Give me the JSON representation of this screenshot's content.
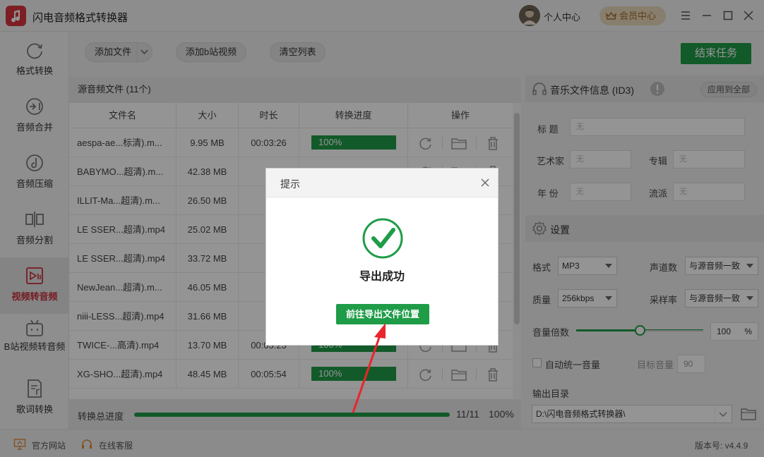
{
  "titlebar": {
    "app_title": "闪电音频格式转换器",
    "user_center": "个人中心",
    "vip_label": "会员中心"
  },
  "sidebar": {
    "items": [
      {
        "label": "格式转换",
        "icon": "refresh-icon"
      },
      {
        "label": "音频合并",
        "icon": "merge-icon"
      },
      {
        "label": "音频压缩",
        "icon": "compress-icon"
      },
      {
        "label": "音频分割",
        "icon": "split-icon"
      },
      {
        "label": "视频转音频",
        "icon": "video-audio-icon",
        "active": true
      },
      {
        "label": "B站视频转音频",
        "icon": "bilibili-icon"
      },
      {
        "label": "歌词转换",
        "icon": "lyrics-icon"
      }
    ]
  },
  "toolbar": {
    "add_file": "添加文件",
    "add_bilibili": "添加b站视频",
    "clear_list": "清空列表",
    "end_task": "结束任务"
  },
  "file_list": {
    "header": "源音频文件 (11个)",
    "columns": [
      "文件名",
      "大小",
      "时长",
      "转换进度",
      "操作"
    ],
    "rows": [
      {
        "name": "aespa-ae...标清).m...",
        "size": "9.95 MB",
        "duration": "00:03:26",
        "progress": "100%"
      },
      {
        "name": "BABYMO...超清).m...",
        "size": "42.38 MB",
        "duration": "",
        "progress": ""
      },
      {
        "name": "ILLIT-Ma...超清).m...",
        "size": "26.50 MB",
        "duration": "0",
        "progress": ""
      },
      {
        "name": "LE SSER...超清).mp4",
        "size": "25.02 MB",
        "duration": "0",
        "progress": ""
      },
      {
        "name": "LE SSER...超清).mp4",
        "size": "33.72 MB",
        "duration": "0",
        "progress": ""
      },
      {
        "name": "NewJean...超清).m...",
        "size": "46.05 MB",
        "duration": "0",
        "progress": ""
      },
      {
        "name": "niii-LESS...超清).mp4",
        "size": "31.66 MB",
        "duration": "0",
        "progress": ""
      },
      {
        "name": "TWICE-...高清).mp4",
        "size": "13.70 MB",
        "duration": "00:03:23",
        "progress": "100%"
      },
      {
        "name": "XG-SHO...超清).mp4",
        "size": "48.45 MB",
        "duration": "00:05:54",
        "progress": "100%"
      }
    ],
    "total_label": "转换总进度",
    "total_count": "11/11",
    "total_percent": "100%"
  },
  "id3": {
    "header": "音乐文件信息 (ID3)",
    "apply_all": "应用到全部",
    "title_label": "标  题",
    "artist_label": "艺术家",
    "album_label": "专辑",
    "year_label": "年  份",
    "genre_label": "流派",
    "placeholder": "无"
  },
  "settings": {
    "header": "设置",
    "format_label": "格式",
    "format_value": "MP3",
    "channels_label": "声道数",
    "channels_value": "与源音频一致",
    "quality_label": "质量",
    "quality_value": "256kbps",
    "samplerate_label": "采样率",
    "samplerate_value": "与源音频一致",
    "volume_label": "音量倍数",
    "volume_value": "100",
    "volume_unit": "%",
    "volume_level": 0.5,
    "auto_volume_label": "自动统一音量",
    "target_volume_label": "目标音量",
    "target_volume_value": "90",
    "output_dir_label": "输出目录",
    "output_dir_value": "D:\\闪电音频格式转换器\\"
  },
  "statusbar": {
    "official_site": "官方网站",
    "online_service": "在线客服",
    "version": "版本号: v4.4.9"
  },
  "dialog": {
    "title": "提示",
    "message": "导出成功",
    "button": "前往导出文件位置"
  },
  "colors": {
    "accent": "#1f9c48",
    "brand": "#d8343f",
    "arrow": "#e8262b"
  }
}
